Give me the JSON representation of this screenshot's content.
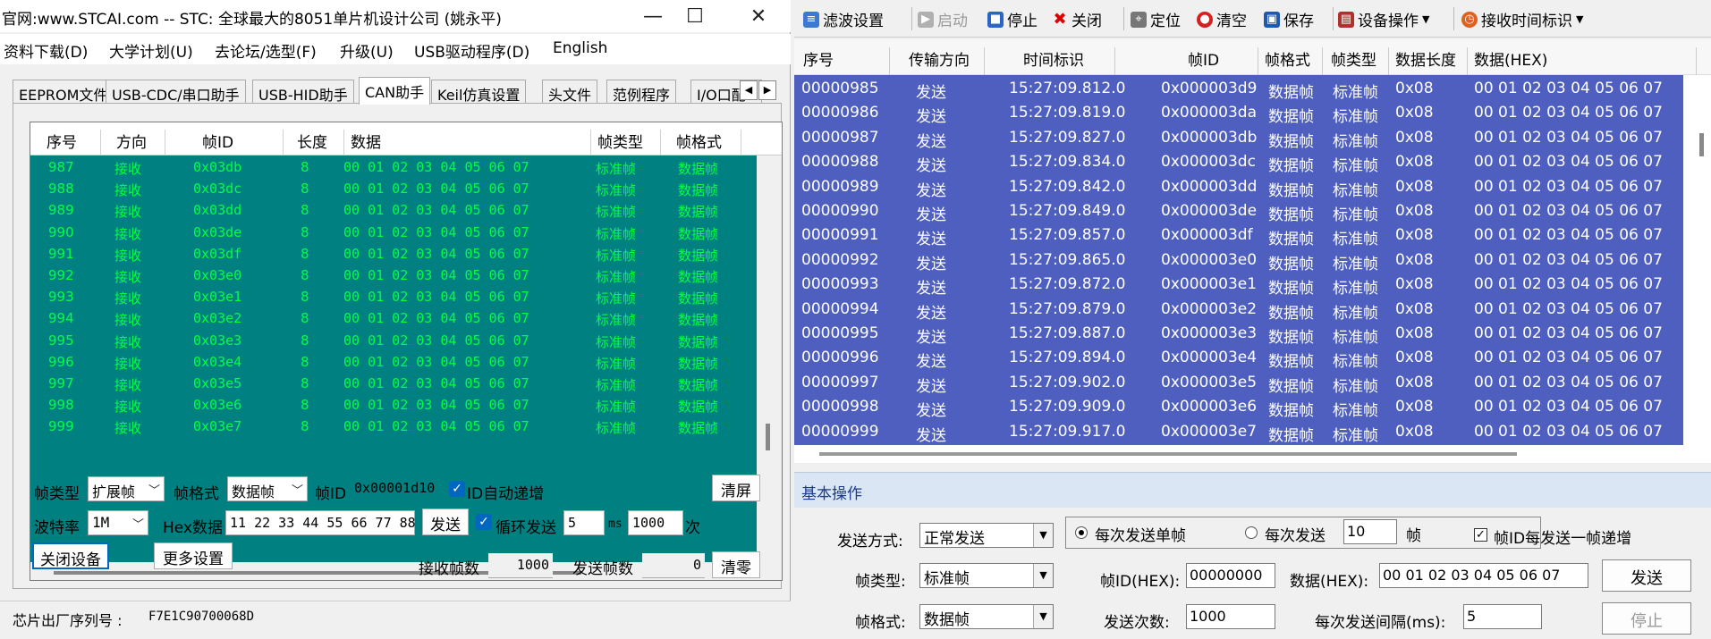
{
  "left_window": {
    "title": "官网:www.STCAI.com  -- STC: 全球最大的8051单片机设计公司 (姚永平)",
    "menu": [
      "资料下载(D)",
      "大学计划(U)",
      "去论坛/选型(F)",
      "升级(U)",
      "USB驱动程序(D)",
      "English"
    ],
    "tabs": [
      "EEPROM文件",
      "USB-CDC/串口助手",
      "USB-HID助手",
      "CAN助手",
      "Keil仿真设置",
      "头文件",
      "范例程序",
      "I/O口配"
    ],
    "grid": {
      "columns": [
        "序号",
        "方向",
        "帧ID",
        "长度",
        "数据",
        "帧类型",
        "帧格式"
      ],
      "rows": [
        [
          "987",
          "接收",
          "0x03db",
          "8",
          "00 01 02 03 04 05 06 07",
          "标准帧",
          "数据帧"
        ],
        [
          "988",
          "接收",
          "0x03dc",
          "8",
          "00 01 02 03 04 05 06 07",
          "标准帧",
          "数据帧"
        ],
        [
          "989",
          "接收",
          "0x03dd",
          "8",
          "00 01 02 03 04 05 06 07",
          "标准帧",
          "数据帧"
        ],
        [
          "990",
          "接收",
          "0x03de",
          "8",
          "00 01 02 03 04 05 06 07",
          "标准帧",
          "数据帧"
        ],
        [
          "991",
          "接收",
          "0x03df",
          "8",
          "00 01 02 03 04 05 06 07",
          "标准帧",
          "数据帧"
        ],
        [
          "992",
          "接收",
          "0x03e0",
          "8",
          "00 01 02 03 04 05 06 07",
          "标准帧",
          "数据帧"
        ],
        [
          "993",
          "接收",
          "0x03e1",
          "8",
          "00 01 02 03 04 05 06 07",
          "标准帧",
          "数据帧"
        ],
        [
          "994",
          "接收",
          "0x03e2",
          "8",
          "00 01 02 03 04 05 06 07",
          "标准帧",
          "数据帧"
        ],
        [
          "995",
          "接收",
          "0x03e3",
          "8",
          "00 01 02 03 04 05 06 07",
          "标准帧",
          "数据帧"
        ],
        [
          "996",
          "接收",
          "0x03e4",
          "8",
          "00 01 02 03 04 05 06 07",
          "标准帧",
          "数据帧"
        ],
        [
          "997",
          "接收",
          "0x03e5",
          "8",
          "00 01 02 03 04 05 06 07",
          "标准帧",
          "数据帧"
        ],
        [
          "998",
          "接收",
          "0x03e6",
          "8",
          "00 01 02 03 04 05 06 07",
          "标准帧",
          "数据帧"
        ],
        [
          "999",
          "接收",
          "0x03e7",
          "8",
          "00 01 02 03 04 05 06 07",
          "标准帧",
          "数据帧"
        ]
      ]
    },
    "controls": {
      "frame_type_label": "帧类型",
      "frame_type_value": "扩展帧",
      "frame_format_label": "帧格式",
      "frame_format_value": "数据帧",
      "frame_id_label": "帧ID",
      "frame_id_value": "0x00001d10",
      "id_auto_inc_label": "ID自动递增",
      "clear_screen": "清屏",
      "baud_label": "波特率",
      "baud_value": "1M",
      "hex_label": "Hex数据",
      "hex_value": "11 22 33 44 55 66 77 88",
      "send_button": "发送",
      "loop_send_label": "循环发送",
      "loop_interval": "5",
      "ms_unit": "ms",
      "loop_count": "1000",
      "times_unit": "次",
      "close_device": "关闭设备",
      "more_settings": "更多设置",
      "recv_count_label": "接收帧数",
      "recv_count": "1000",
      "send_count_label": "发送帧数",
      "send_count": "0",
      "clear_zero": "清零"
    },
    "status": {
      "chip_label": "芯片出厂序列号 :",
      "chip_serial": "F7E1C90700068D"
    },
    "colors": {
      "grid_bg": "#008080",
      "grid_text": "#00ff40"
    }
  },
  "right_window": {
    "toolbar": [
      {
        "label": "滤波设置",
        "icon": "filter-icon",
        "enabled": true
      },
      {
        "label": "启动",
        "icon": "start-icon",
        "enabled": false
      },
      {
        "label": "停止",
        "icon": "stop-icon",
        "enabled": true
      },
      {
        "label": "关闭",
        "icon": "close-icon",
        "enabled": true
      },
      {
        "label": "定位",
        "icon": "locate-icon",
        "enabled": true
      },
      {
        "label": "清空",
        "icon": "clear-icon",
        "enabled": true
      },
      {
        "label": "保存",
        "icon": "save-icon",
        "enabled": true
      },
      {
        "label": "设备操作",
        "icon": "device-icon",
        "enabled": true
      },
      {
        "label": "接收时间标识",
        "icon": "clock-icon",
        "enabled": true
      }
    ],
    "grid": {
      "columns": [
        "序号",
        "传输方向",
        "时间标识",
        "帧ID",
        "帧格式",
        "帧类型",
        "数据长度",
        "数据(HEX)"
      ],
      "rows": [
        [
          "00000985",
          "发送",
          "15:27:09.812.0",
          "0x000003d9",
          "数据帧",
          "标准帧",
          "0x08",
          "00 01 02 03 04 05 06 07"
        ],
        [
          "00000986",
          "发送",
          "15:27:09.819.0",
          "0x000003da",
          "数据帧",
          "标准帧",
          "0x08",
          "00 01 02 03 04 05 06 07"
        ],
        [
          "00000987",
          "发送",
          "15:27:09.827.0",
          "0x000003db",
          "数据帧",
          "标准帧",
          "0x08",
          "00 01 02 03 04 05 06 07"
        ],
        [
          "00000988",
          "发送",
          "15:27:09.834.0",
          "0x000003dc",
          "数据帧",
          "标准帧",
          "0x08",
          "00 01 02 03 04 05 06 07"
        ],
        [
          "00000989",
          "发送",
          "15:27:09.842.0",
          "0x000003dd",
          "数据帧",
          "标准帧",
          "0x08",
          "00 01 02 03 04 05 06 07"
        ],
        [
          "00000990",
          "发送",
          "15:27:09.849.0",
          "0x000003de",
          "数据帧",
          "标准帧",
          "0x08",
          "00 01 02 03 04 05 06 07"
        ],
        [
          "00000991",
          "发送",
          "15:27:09.857.0",
          "0x000003df",
          "数据帧",
          "标准帧",
          "0x08",
          "00 01 02 03 04 05 06 07"
        ],
        [
          "00000992",
          "发送",
          "15:27:09.865.0",
          "0x000003e0",
          "数据帧",
          "标准帧",
          "0x08",
          "00 01 02 03 04 05 06 07"
        ],
        [
          "00000993",
          "发送",
          "15:27:09.872.0",
          "0x000003e1",
          "数据帧",
          "标准帧",
          "0x08",
          "00 01 02 03 04 05 06 07"
        ],
        [
          "00000994",
          "发送",
          "15:27:09.879.0",
          "0x000003e2",
          "数据帧",
          "标准帧",
          "0x08",
          "00 01 02 03 04 05 06 07"
        ],
        [
          "00000995",
          "发送",
          "15:27:09.887.0",
          "0x000003e3",
          "数据帧",
          "标准帧",
          "0x08",
          "00 01 02 03 04 05 06 07"
        ],
        [
          "00000996",
          "发送",
          "15:27:09.894.0",
          "0x000003e4",
          "数据帧",
          "标准帧",
          "0x08",
          "00 01 02 03 04 05 06 07"
        ],
        [
          "00000997",
          "发送",
          "15:27:09.902.0",
          "0x000003e5",
          "数据帧",
          "标准帧",
          "0x08",
          "00 01 02 03 04 05 06 07"
        ],
        [
          "00000998",
          "发送",
          "15:27:09.909.0",
          "0x000003e6",
          "数据帧",
          "标准帧",
          "0x08",
          "00 01 02 03 04 05 06 07"
        ],
        [
          "00000999",
          "发送",
          "15:27:09.917.0",
          "0x000003e7",
          "数据帧",
          "标准帧",
          "0x08",
          "00 01 02 03 04 05 06 07"
        ]
      ]
    },
    "ops": {
      "section_title": "基本操作",
      "send_mode_label": "发送方式:",
      "send_mode_value": "正常发送",
      "radio_single": "每次发送单帧",
      "radio_multi": "每次发送",
      "multi_count": "10",
      "frame_unit": "帧",
      "id_inc_label": "帧ID每发送一帧递增",
      "frame_type_label": "帧类型:",
      "frame_type_value": "标准帧",
      "frame_id_label": "帧ID(HEX):",
      "frame_id_value": "00000000",
      "data_label": "数据(HEX):",
      "data_value": "00 01 02 03 04 05 06 07",
      "send_button": "发送",
      "frame_format_label": "帧格式:",
      "frame_format_value": "数据帧",
      "send_count_label": "发送次数:",
      "send_count_value": "1000",
      "interval_label": "每次发送间隔(ms):",
      "interval_value": "5",
      "stop_button": "停止"
    },
    "colors": {
      "grid_bg": "#4e5fbf",
      "grid_text": "#ffffff"
    }
  }
}
